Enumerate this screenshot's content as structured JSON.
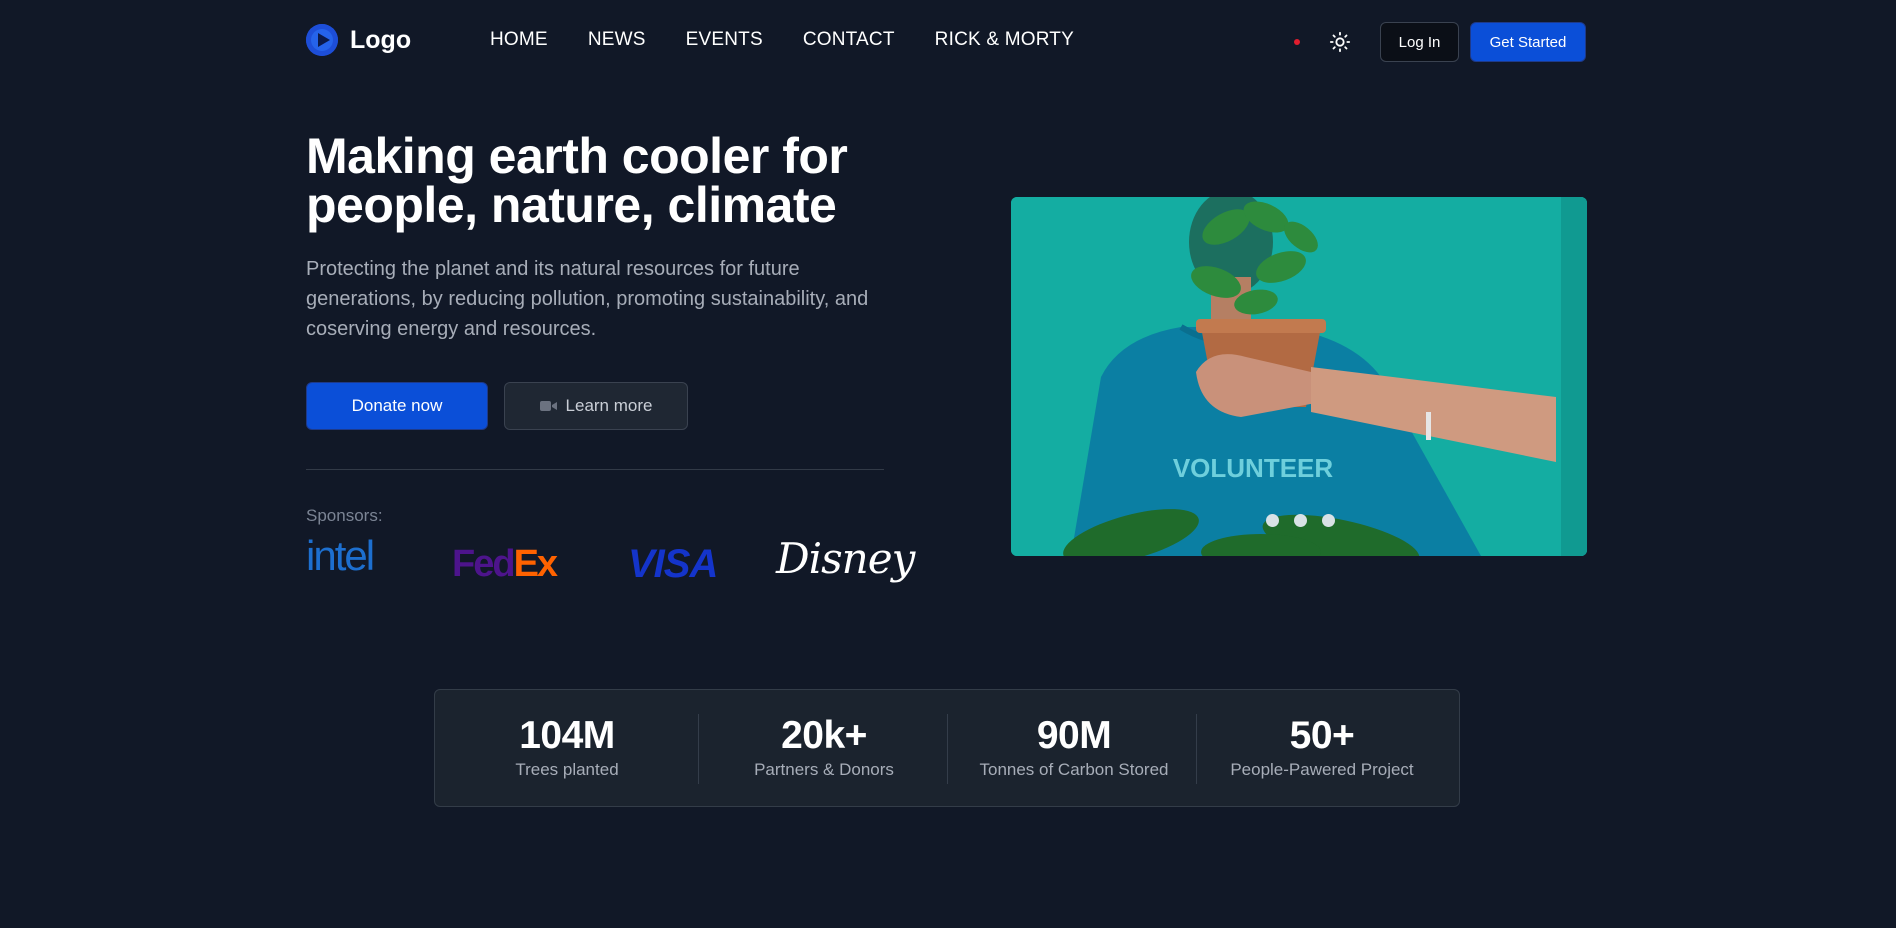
{
  "header": {
    "logo_text": "Logo",
    "nav": [
      "HOME",
      "NEWS",
      "EVENTS",
      "CONTACT",
      "RICK & MORTY"
    ],
    "login_label": "Log In",
    "get_started_label": "Get Started"
  },
  "hero": {
    "title": "Making earth cooler for people, nature, climate",
    "subtitle": "Protecting the planet and its natural resources for future generations, by reducing pollution, promoting sustainability, and coserving energy and resources.",
    "donate_label": "Donate now",
    "learn_label": "Learn more"
  },
  "sponsors": {
    "label": "Sponsors:",
    "items": [
      "intel",
      "FedEx",
      "VISA",
      "Disney"
    ]
  },
  "carousel": {
    "shirt_text": "VOLUNTEER",
    "slide_count": 3
  },
  "stats": [
    {
      "value": "104M",
      "label": "Trees planted"
    },
    {
      "value": "20k+",
      "label": "Partners & Donors"
    },
    {
      "value": "90M",
      "label": "Tonnes of Carbon Stored"
    },
    {
      "value": "50+",
      "label": "People-Pawered Project"
    }
  ],
  "colors": {
    "background": "#111827",
    "accent": "#0b4fd8",
    "notification": "#e11d2e"
  },
  "icons": {
    "logo": "logo-play-icon",
    "theme": "sun-icon",
    "learn": "video-camera-icon"
  }
}
